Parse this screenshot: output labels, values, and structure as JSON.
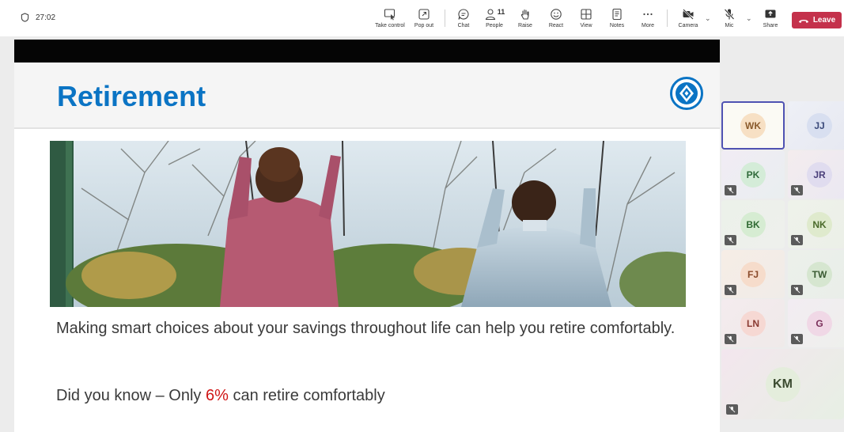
{
  "meeting": {
    "timer": "27:02",
    "toolbar": {
      "take_control": "Take control",
      "pop_out": "Pop out",
      "chat": "Chat",
      "people": "People",
      "people_count": "11",
      "raise": "Raise",
      "react": "React",
      "view": "View",
      "notes": "Notes",
      "more": "More",
      "camera": "Camera",
      "mic": "Mic",
      "share": "Share",
      "leave": "Leave"
    },
    "colors": {
      "leave": "#c4314b",
      "accent": "#4f52b2"
    }
  },
  "slide": {
    "title": "Retirement",
    "caption": "Making smart choices about your savings throughout life can help you retire comfortably.",
    "did_you_know_prefix": "Did you know – Only ",
    "did_you_know_pct": "6%",
    "did_you_know_suffix": " can retire comfortably",
    "colors": {
      "title": "#0b74c4",
      "highlight": "#d01515"
    }
  },
  "participants": [
    {
      "initials": "WK",
      "active": true,
      "muted": false
    },
    {
      "initials": "JJ",
      "active": false,
      "muted": false
    },
    {
      "initials": "PK",
      "active": false,
      "muted": true
    },
    {
      "initials": "JR",
      "active": false,
      "muted": true
    },
    {
      "initials": "BK",
      "active": false,
      "muted": true
    },
    {
      "initials": "NK",
      "active": false,
      "muted": true
    },
    {
      "initials": "FJ",
      "active": false,
      "muted": true
    },
    {
      "initials": "TW",
      "active": false,
      "muted": true
    },
    {
      "initials": "LN",
      "active": false,
      "muted": true
    },
    {
      "initials": "G",
      "active": false,
      "muted": true
    },
    {
      "initials": "KM",
      "active": false,
      "muted": true
    }
  ]
}
